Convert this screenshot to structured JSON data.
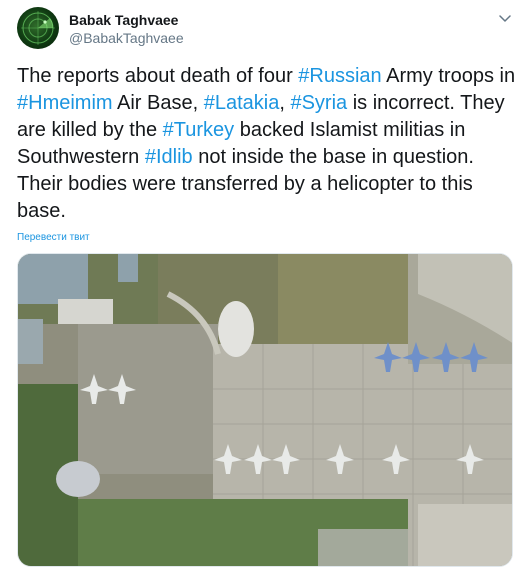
{
  "author": {
    "display_name": "Babak Taghvaee",
    "handle": "@BabakTaghvaee"
  },
  "tweet": {
    "segments": [
      {
        "text": "The reports about death of four ",
        "type": "text"
      },
      {
        "text": "#Russian",
        "type": "hashtag"
      },
      {
        "text": " Army troops in ",
        "type": "text"
      },
      {
        "text": "#Hmeimim",
        "type": "hashtag"
      },
      {
        "text": " Air Base, ",
        "type": "text"
      },
      {
        "text": "#Latakia",
        "type": "hashtag"
      },
      {
        "text": ", ",
        "type": "text"
      },
      {
        "text": "#Syria",
        "type": "hashtag"
      },
      {
        "text": " is incorrect. They are killed by the ",
        "type": "text"
      },
      {
        "text": "#Turkey",
        "type": "hashtag"
      },
      {
        "text": " backed Islamist militias in Southwestern ",
        "type": "text"
      },
      {
        "text": "#Idlib",
        "type": "hashtag"
      },
      {
        "text": " not inside the base in question. Their bodies were transferred by a helicopter to this base.",
        "type": "text"
      }
    ],
    "translate_label": "Перевести твит"
  },
  "colors": {
    "hashtag": "#1b95e0",
    "name": "#14171a",
    "handle": "#657786"
  },
  "icons": {
    "chevron": "chevron-down-icon",
    "avatar": "radar-avatar"
  }
}
